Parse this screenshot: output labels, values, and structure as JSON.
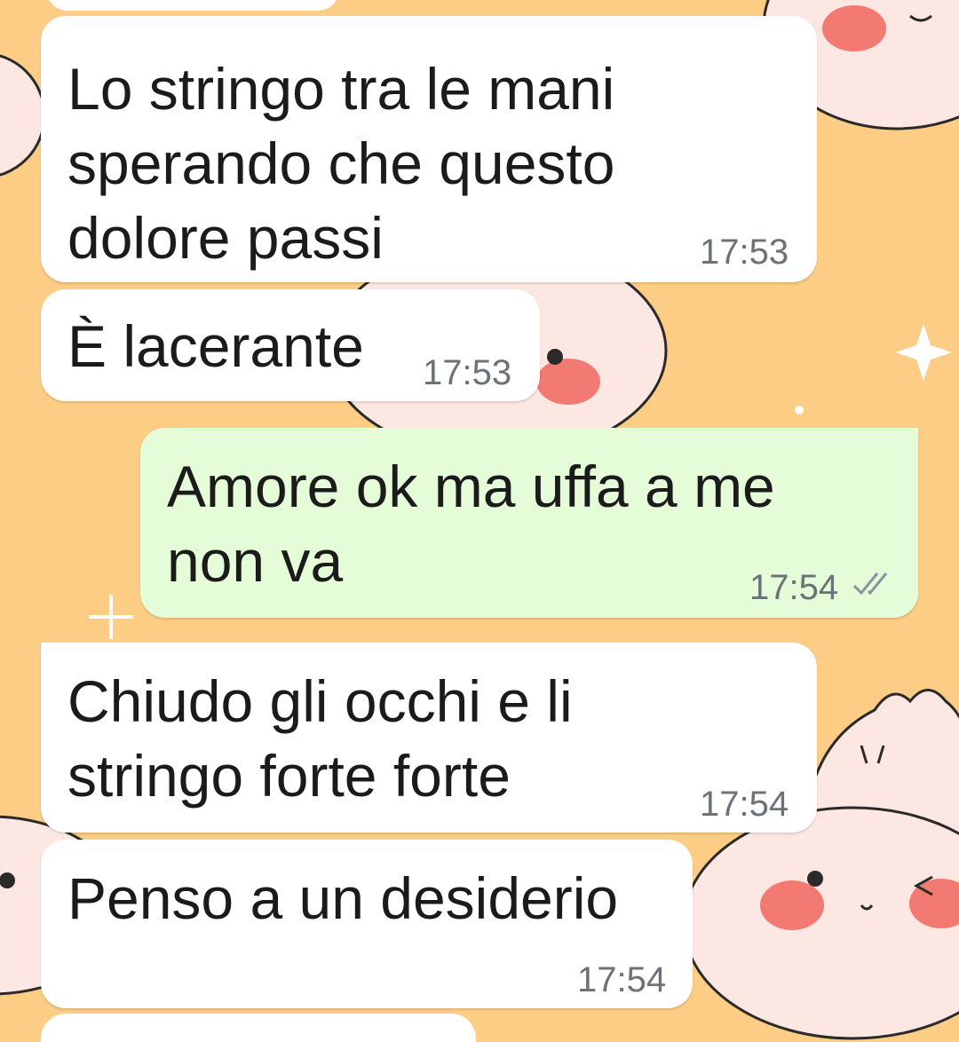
{
  "wallpaper": {
    "background": "#fdcc85",
    "face_color": "#fde7e2",
    "cheek_color": "#f37a72"
  },
  "messages": [
    {
      "direction": "in",
      "text": "Lo stringo tra le mani\nsperando che questo\ndolore passi",
      "time": "17:53"
    },
    {
      "direction": "in",
      "text": "È lacerante",
      "time": "17:53"
    },
    {
      "direction": "out",
      "text": "Amore ok ma uffa a me\nnon va",
      "time": "17:54",
      "status": "read-ticks-icon"
    },
    {
      "direction": "in",
      "text": "Chiudo gli occhi e li\nstringo forte forte",
      "time": "17:54"
    },
    {
      "direction": "in",
      "text": "Penso a un desiderio",
      "time": "17:54"
    }
  ],
  "colors": {
    "incoming_bubble": "#ffffff",
    "outgoing_bubble": "#e5fcd8",
    "text": "#1b1b1b",
    "timestamp": "#6b7278",
    "tick": "#8b949b"
  }
}
